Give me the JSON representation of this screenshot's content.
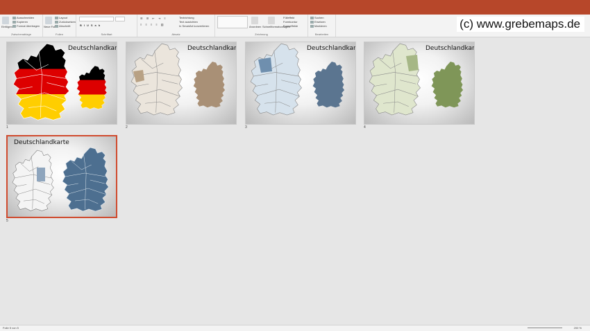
{
  "watermark": "(c) www.grebemaps.de",
  "ribbon": {
    "groups": [
      {
        "label": "Zwischenablage",
        "items": [
          "Ausschneiden",
          "Kopieren",
          "Format übertragen"
        ],
        "big": "Einfügen"
      },
      {
        "label": "Folien",
        "items": [
          "Layout",
          "Zurücksetzen",
          "Abschnitt"
        ],
        "big": "Neue Folie"
      },
      {
        "label": "Schriftart",
        "items": []
      },
      {
        "label": "Absatz",
        "items": []
      },
      {
        "label": "Zeichnung",
        "items": [
          "Anordnen",
          "Schnellformatvorlagen"
        ]
      },
      {
        "label": "Bearbeiten",
        "items": [
          "Suchen",
          "Ersetzen",
          "Markieren"
        ]
      }
    ],
    "extra_items": [
      "Textrichtung",
      "Text ausrichten",
      "In SmartArt konvertieren",
      "Fülleffekt",
      "Formkontur",
      "Formeffekte"
    ]
  },
  "slides": [
    {
      "number": "1",
      "title": "Deutschlandkarte",
      "theme": "flag",
      "colors": {
        "map": "#000000",
        "flag_top": "#000000",
        "flag_mid": "#dd0000",
        "flag_bot": "#ffce00"
      }
    },
    {
      "number": "2",
      "title": "Deutschlandkarte",
      "theme": "beige",
      "colors": {
        "map": "#ebe5dc",
        "highlight": "#b8a184",
        "solid": "#a99076"
      }
    },
    {
      "number": "3",
      "title": "Deutschlandkarte",
      "theme": "blue",
      "colors": {
        "map": "#d6e2ec",
        "highlight": "#6f8fae",
        "solid": "#5b7590"
      }
    },
    {
      "number": "4",
      "title": "Deutschlandkarte",
      "theme": "green",
      "colors": {
        "map": "#dfe6cd",
        "highlight": "#a6b786",
        "solid": "#7f9658"
      }
    },
    {
      "number": "5",
      "title": "Deutschlandkarte",
      "theme": "slate",
      "colors": {
        "map": "#f4f4f4",
        "highlight": "#8ea5bd",
        "solid": "#4d6f90"
      },
      "selected": true
    }
  ],
  "status": {
    "slide_info": "Folie 5 von 5",
    "zoom": "200 %"
  }
}
